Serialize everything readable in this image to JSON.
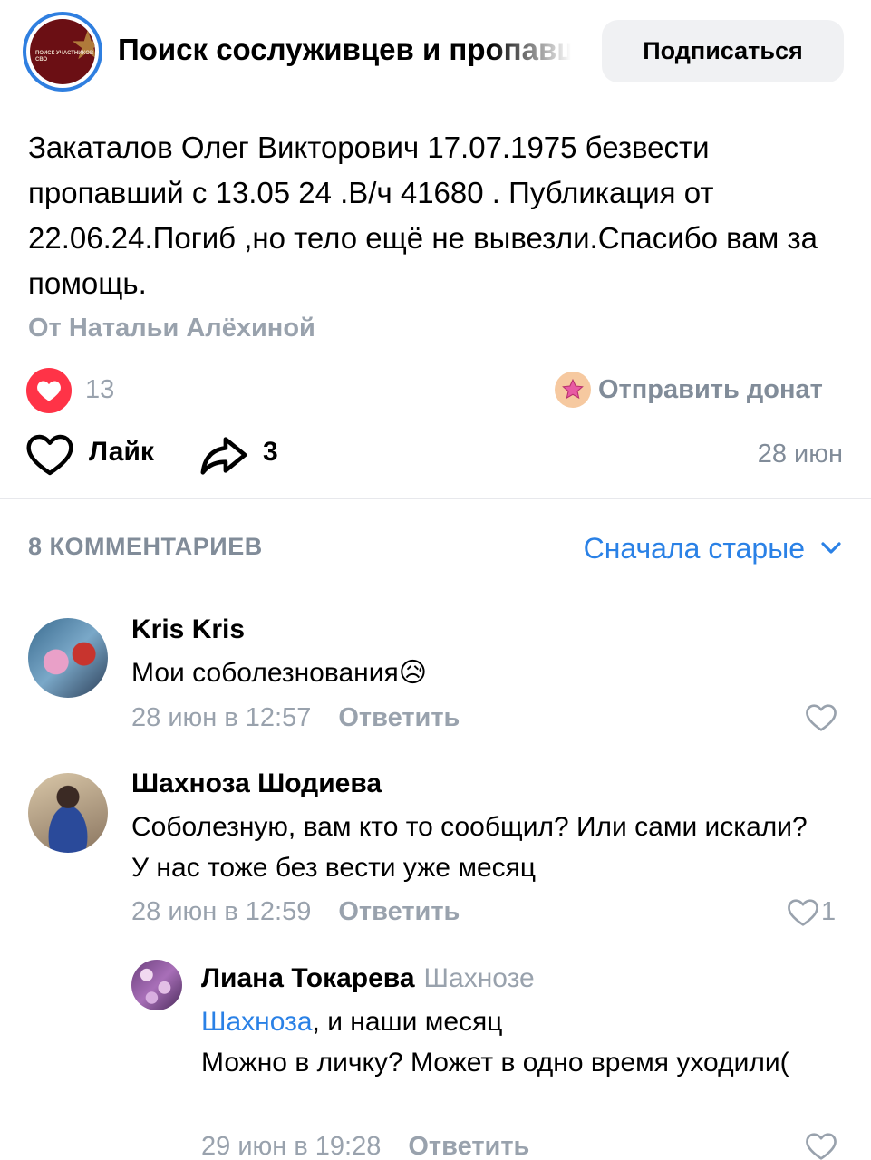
{
  "group": {
    "title": "Поиск сослуживцев и пропавших",
    "logo_text": "ПОИСК УЧАСТНИКОВ СВО",
    "subscribe_label": "Подписаться"
  },
  "post": {
    "text": "Закаталов Олег Викторович 17.07.1975 безвести пропавший с 13.05 24 .В/ч 41680 . Публикация от 22.06.24.Погиб ,но тело ещё не вывезли.Спасибо вам за помощь.",
    "author": "От Натальи Алёхиной",
    "likes_count": "13",
    "donate_label": "Отправить донат",
    "like_label": "Лайк",
    "shares_count": "3",
    "date": "28 июн"
  },
  "comments_section": {
    "count_label": "8 КОММЕНТАРИЕВ",
    "sort_label": "Сначала старые"
  },
  "comments": [
    {
      "name": "Kris Kris",
      "text": "Мои соболезнования😥",
      "time": "28 июн в 12:57",
      "reply_label": "Ответить",
      "likes": ""
    },
    {
      "name": "Шахноза Шодиева",
      "text": "Соболезную, вам кто то сообщил? Или сами искали? У нас тоже без вести уже месяц",
      "time": "28 июн в 12:59",
      "reply_label": "Ответить",
      "likes": "1"
    },
    {
      "name": "Лиана Токарева",
      "reply_to": "Шахнозе",
      "mention": "Шахноза",
      "text_after_mention": ", и наши месяц",
      "text_rest": "Можно в личку? Может в одно время уходили(",
      "time": "29 июн в 19:28",
      "reply_label": "Ответить",
      "likes": ""
    }
  ],
  "colors": {
    "accent": "#2a81e6",
    "like_red": "#ff3347",
    "secondary_text": "#99a2ad",
    "divider": "#e7e8ec",
    "button_bg": "#f0f1f3"
  },
  "icons": [
    "heart-filled-icon",
    "heart-outline-icon",
    "share-icon",
    "donate-star-icon",
    "chevron-down-icon"
  ]
}
